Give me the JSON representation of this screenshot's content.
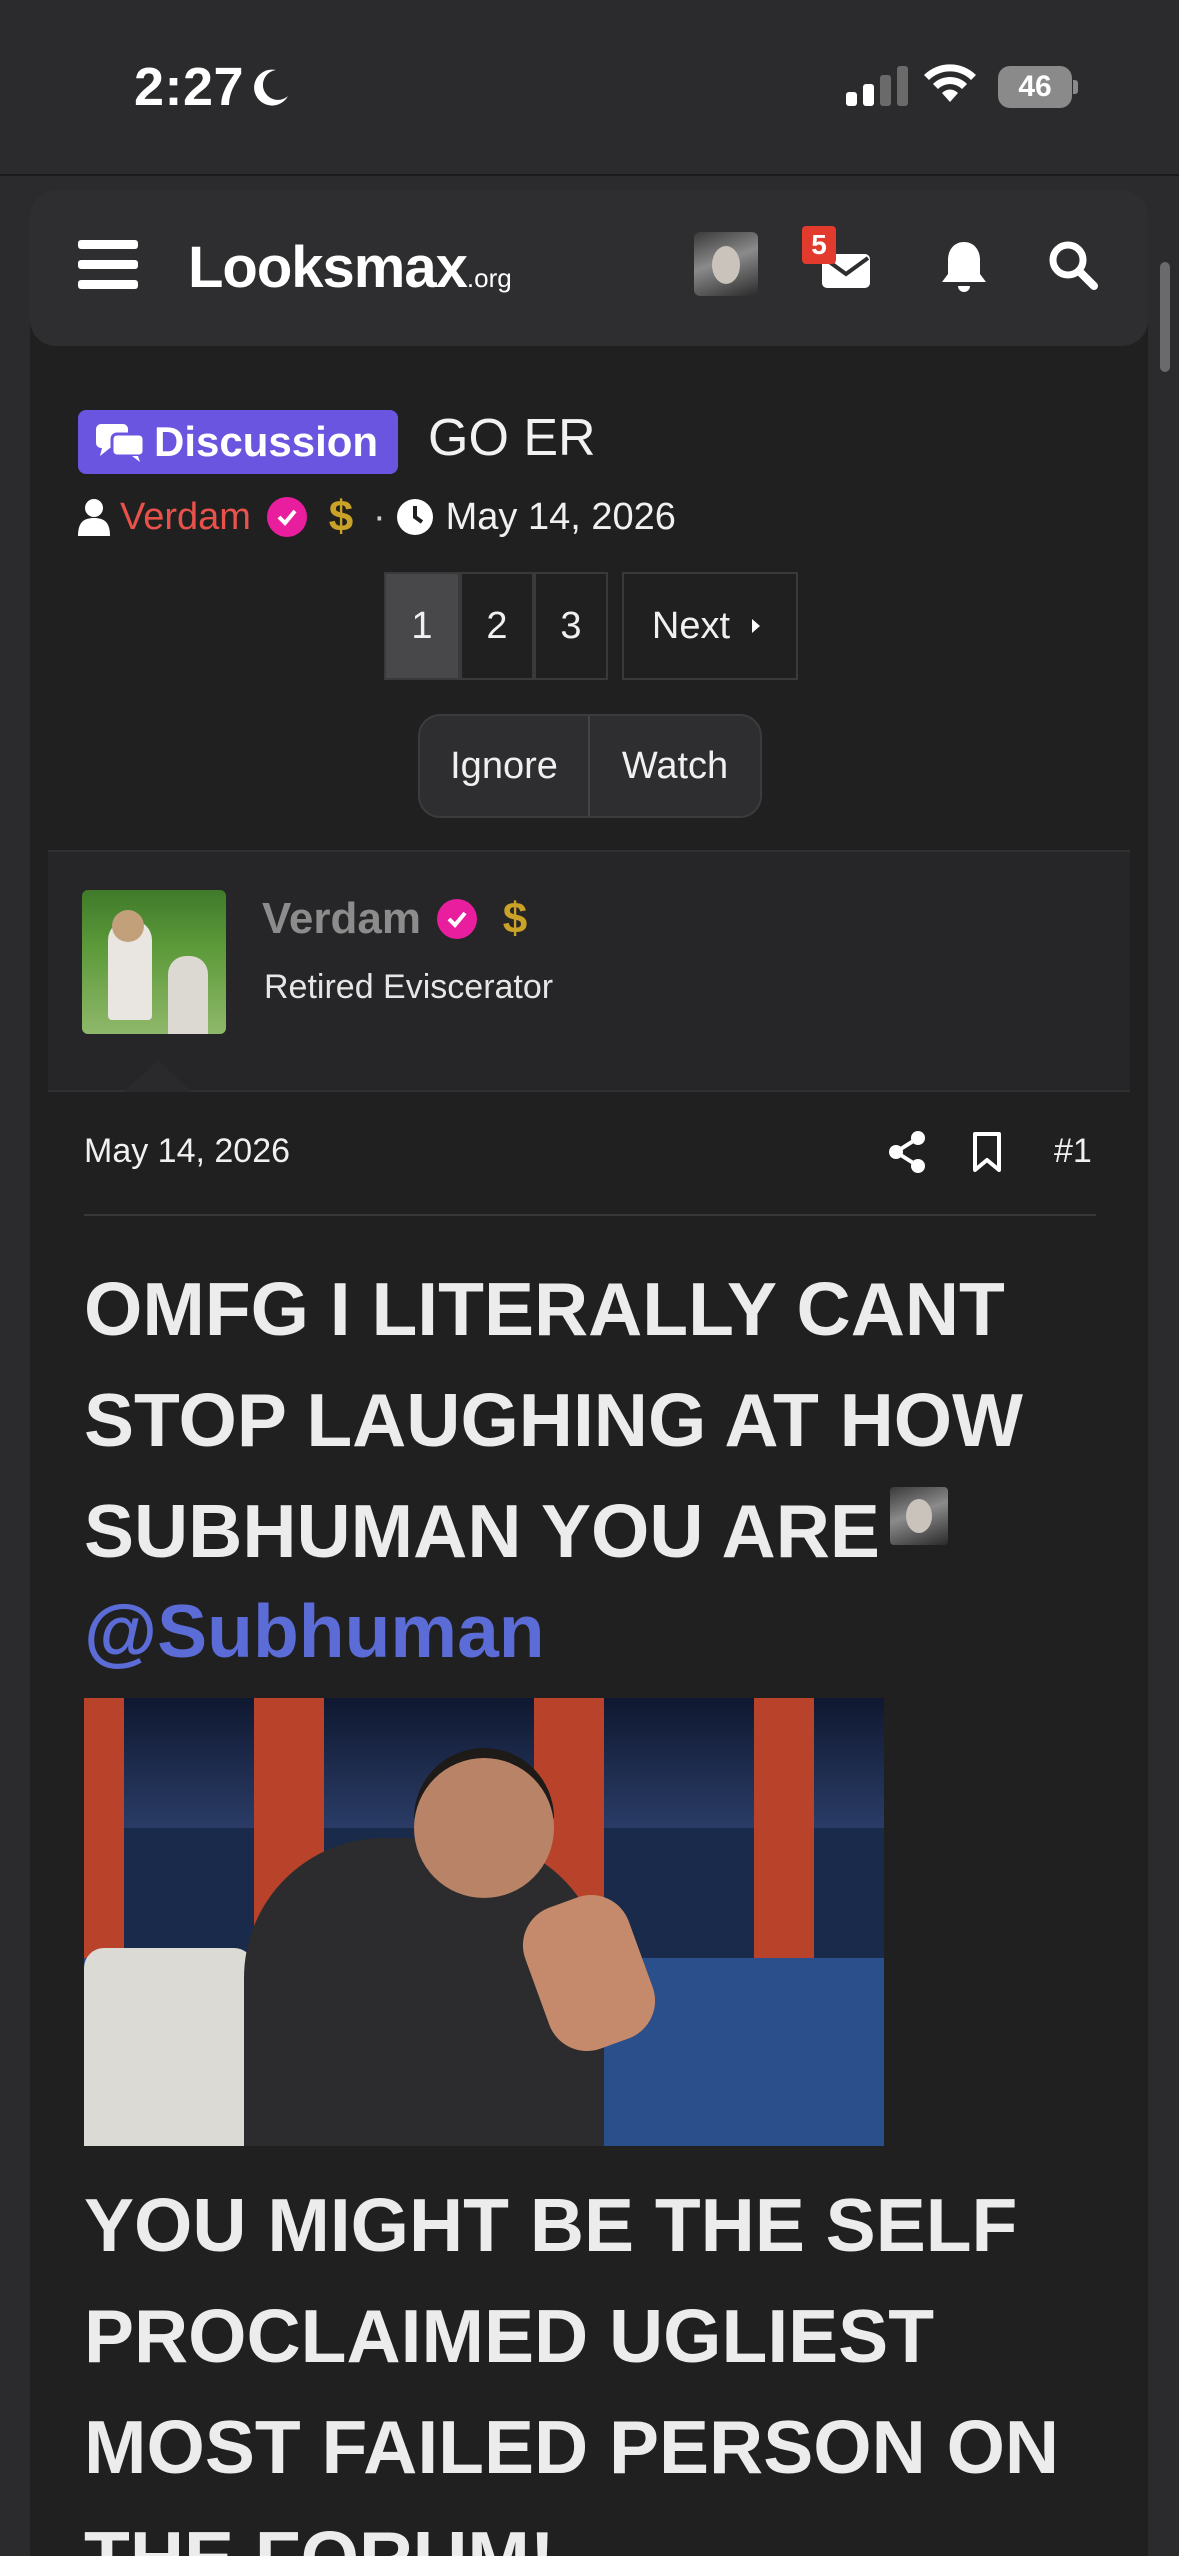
{
  "status_bar": {
    "time": "2:27",
    "battery": "46"
  },
  "site": {
    "logo_main": "Looksmax",
    "logo_suffix": ".org",
    "notification_count": "5"
  },
  "thread": {
    "prefix_label": "Discussion",
    "title": "GO ER",
    "author": "Verdam",
    "separator": "·",
    "date": "May 14, 2026"
  },
  "pagination": {
    "pages": [
      "1",
      "2",
      "3"
    ],
    "current_page": "1",
    "next_label": "Next"
  },
  "actions": {
    "ignore_label": "Ignore",
    "watch_label": "Watch"
  },
  "author_card": {
    "name": "Verdam",
    "user_title": "Retired Eviscerator",
    "dollar_symbol": "$"
  },
  "post": {
    "date": "May 14, 2026",
    "number": "#1",
    "text_1": "OMFG I LITERALLY CANT STOP LAUGHING AT HOW SUBHUMAN YOU ARE",
    "mention": "@Subhuman",
    "text_2": "YOU MIGHT BE THE SELF PROCLAIMED UGLIEST MOST FAILED PERSON ON THE FORUM!"
  },
  "colors": {
    "background": "#202021",
    "header": "#2e2e30",
    "prefix_purple": "#6a55e0",
    "author_red": "#e8524a",
    "verified_pink": "#e81e9e",
    "mention_blue": "#5c6cd6",
    "badge_red": "#e23b2e"
  }
}
